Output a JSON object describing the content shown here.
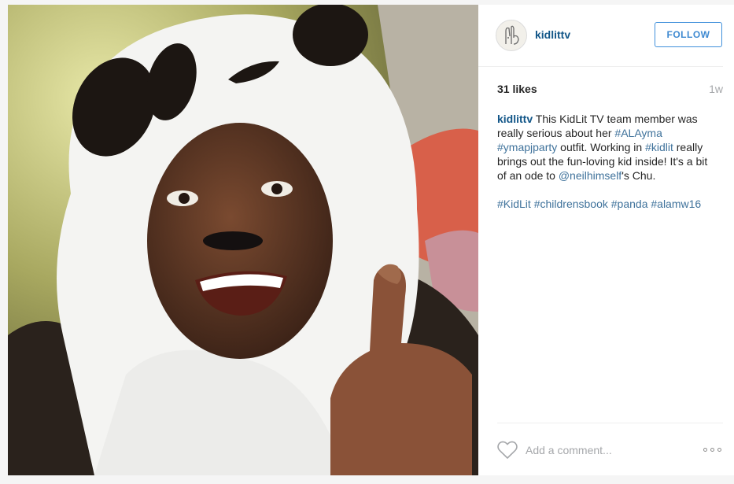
{
  "post": {
    "username": "kidlittv",
    "follow_label": "FOLLOW",
    "likes": "31 likes",
    "time": "1w",
    "caption": {
      "user": "kidlittv",
      "text_1": " This KidLit TV team member was really serious about her ",
      "tag_alayma": "#ALAyma",
      "text_2": " ",
      "tag_ymapjparty": "#ymapjparty",
      "text_3": " outfit. Working in ",
      "tag_kidlit": "#kidlit",
      "text_4": " really brings out the fun-loving kid inside! It's a bit of an ode to ",
      "mention": "@neilhimself",
      "text_5": "'s Chu.",
      "hashtags": [
        "#KidLit",
        "#childrensbook",
        "#panda",
        "#alamw16"
      ]
    },
    "comment_placeholder": "Add a comment...",
    "icons": {
      "heart": "heart-icon",
      "more": "more-options-icon",
      "avatar": "avatar"
    },
    "colors": {
      "username": "#125688",
      "link": "#3f729b",
      "follow": "#3f8ad1",
      "muted": "#a5a7aa"
    }
  }
}
